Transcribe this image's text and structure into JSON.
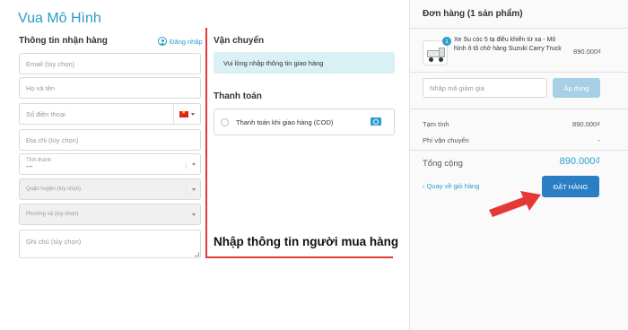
{
  "brand": "Vua Mô Hình",
  "recipient": {
    "title": "Thông tin nhận hàng",
    "login_label": "Đăng nhập",
    "email_placeholder": "Email (tùy chọn)",
    "name_placeholder": "Họ và tên",
    "phone_placeholder": "Số điện thoại",
    "address_placeholder": "Địa chỉ (tùy chọn)",
    "province_label": "Tỉnh thành",
    "province_value": "---",
    "district_placeholder": "Quận huyện (tùy chọn)",
    "ward_placeholder": "Phường xã (tùy chọn)",
    "note_placeholder": "Ghi chú (tùy chọn)"
  },
  "shipping": {
    "title": "Vận chuyển",
    "notice": "Vui lòng nhập thông tin giao hàng"
  },
  "payment": {
    "title": "Thanh toán",
    "cod_label": "Thanh toán khi giao hàng (COD)"
  },
  "annotation": {
    "caption": "Nhập thông tin người mua hàng",
    "accent_color": "#e53935"
  },
  "order": {
    "title": "Đơn hàng (1 sản phẩm)",
    "item": {
      "quantity": "1",
      "name": "Xe Su cóc 5 tạ điều khiển từ xa - Mô hình ô tô chở hàng Suzuki Carry Truck",
      "price": "890.000₫"
    },
    "discount_placeholder": "Nhập mã giảm giá",
    "apply_label": "Áp dụng",
    "subtotal_label": "Tạm tính",
    "subtotal_value": "890.000₫",
    "shipping_fee_label": "Phí vận chuyển",
    "shipping_fee_value": "-",
    "total_label": "Tổng cộng",
    "total_value": "890.000₫",
    "back_label": "‹ Quay về giỏ hàng",
    "place_order_label": "ĐẶT HÀNG"
  },
  "colors": {
    "brand": "#2a9dcc",
    "primary_button": "#2a7fc4",
    "notice_bg": "#d9f0f4"
  },
  "icons": [
    "user-circle-icon",
    "vietnam-flag-icon",
    "cash-icon",
    "truck-thumbnail",
    "red-arrow-icon"
  ]
}
